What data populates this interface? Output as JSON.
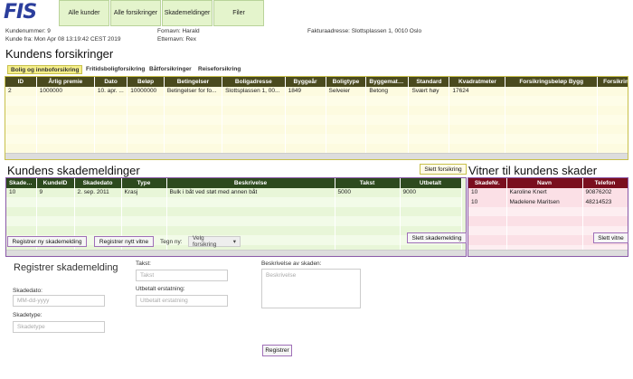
{
  "app": {
    "logo_text": "FIS"
  },
  "nav": {
    "items": [
      "Alle kunder",
      "Alle forsikringer",
      "Skademeldinger",
      "Filer"
    ]
  },
  "customer": {
    "kundenummer_label": "Kundenummer:",
    "kundenummer": "9",
    "kundefra_label": "Kunde fra:",
    "kundefra": "Mon Apr 08 13:19:42 CEST 2019",
    "fornavn_label": "Fornavn:",
    "fornavn": "Harald",
    "etternavn_label": "Etternavn:",
    "etternavn": "Rex",
    "faktura_label": "Fakturaadresse:",
    "faktura": "Slottsplassen 1, 0010 Oslo"
  },
  "insurance": {
    "heading": "Kundens forsikringer",
    "tabs": [
      "Bolig og innboforsikring",
      "Fritidsboligforsikring",
      "Båtforsikringer",
      "Reiseforsikring"
    ],
    "columns": [
      "ID",
      "Årlig premie",
      "Dato",
      "Beløp",
      "Betingelser",
      "Boligadresse",
      "Byggeår",
      "Boligtype",
      "Byggemate...",
      "Standard",
      "Kvadratmeter",
      "Forsikringsbeløp Bygg",
      "Forsikring"
    ],
    "rows": [
      [
        "2",
        "1000000",
        "10. apr. ...",
        "10000000",
        "Betingelser for fo...",
        "Slottsplassen 1, 00...",
        "1849",
        "Selveier",
        "Betong",
        "Svært høy",
        "17624",
        "",
        ""
      ]
    ],
    "delete_button": "Slett forsikring"
  },
  "damages": {
    "heading": "Kundens skademeldinger",
    "columns": [
      "SkadeNr.",
      "KundeID",
      "Skadedato",
      "Type",
      "Beskrivelse",
      "Takst",
      "Utbetalt"
    ],
    "rows": [
      [
        "10",
        "9",
        "2. sep. 2011",
        "Krasj",
        "Bulk i båt ved støt med annen båt",
        "5000",
        "9000"
      ]
    ],
    "delete_button": "Slett skademelding"
  },
  "witnesses": {
    "heading": "Vitner til kundens skader",
    "columns": [
      "SkadeNr.",
      "Navn",
      "Telefon"
    ],
    "rows": [
      [
        "10",
        "Karoline Knert",
        "90876202"
      ],
      [
        "10",
        "Madelene Maritsen",
        "48214523"
      ]
    ],
    "delete_button": "Slett vitne"
  },
  "actions": {
    "register_damage": "Registrer ny skademelding",
    "register_witness": "Registrer nytt vitne",
    "draw_label": "Tegn ny:",
    "draw_select": "Velg forsikring"
  },
  "form": {
    "title": "Registrer skademelding",
    "date_label": "Skadedato:",
    "date_placeholder": "MM-dd-yyyy",
    "type_label": "Skadetype:",
    "type_placeholder": "Skadetype",
    "takst_label": "Takst:",
    "takst_placeholder": "Takst",
    "paid_label": "Utbetalt erstatning:",
    "paid_placeholder": "Utbetalt erstatning",
    "desc_label": "Beskrivelse av skaden:",
    "desc_placeholder": "Beskrivelse",
    "submit": "Registrer"
  },
  "colors": {
    "nav_bg": "#e4f4cc",
    "ins_header": "#4a4a1e",
    "ins_row": "#fdfbe0",
    "dmg_header": "#2d4a1e",
    "dmg_row": "#e8f6d8",
    "wit_header": "#7a0f1e",
    "wit_row": "#fbe0e6",
    "border_purple": "#8a58a8"
  }
}
